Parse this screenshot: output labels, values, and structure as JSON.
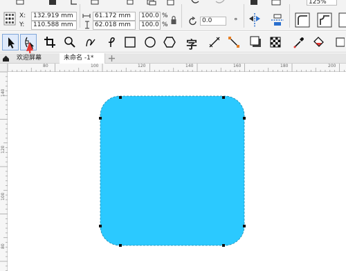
{
  "property_bar": {
    "x_label": "X:",
    "y_label": "Y:",
    "x_value": "132.919 mm",
    "y_value": "110.588 mm",
    "width_value": "61.172 mm",
    "height_value": "62.018 mm",
    "scale_x": "100.0",
    "scale_y": "100.0",
    "percent_x": "%",
    "percent_y": "%",
    "rotation_value": "0.0",
    "degree_symbol": "°",
    "zoom_value": "125%"
  },
  "toolbox": {
    "text_tool_glyph": "字"
  },
  "tabs": [
    {
      "label": "欢迎屏幕"
    },
    {
      "label": "未命名 -1*"
    }
  ],
  "ruler_h_labels": [
    "80",
    "100",
    "120",
    "140",
    "160",
    "180",
    "200"
  ],
  "ruler_v_labels": [
    "140",
    "120",
    "100",
    "80"
  ],
  "colors": {
    "shape_fill": "#2bc9ff",
    "accent": "#2a6fce",
    "arrow": "#e53935",
    "toolbar_bg": "#f3f3f3"
  }
}
